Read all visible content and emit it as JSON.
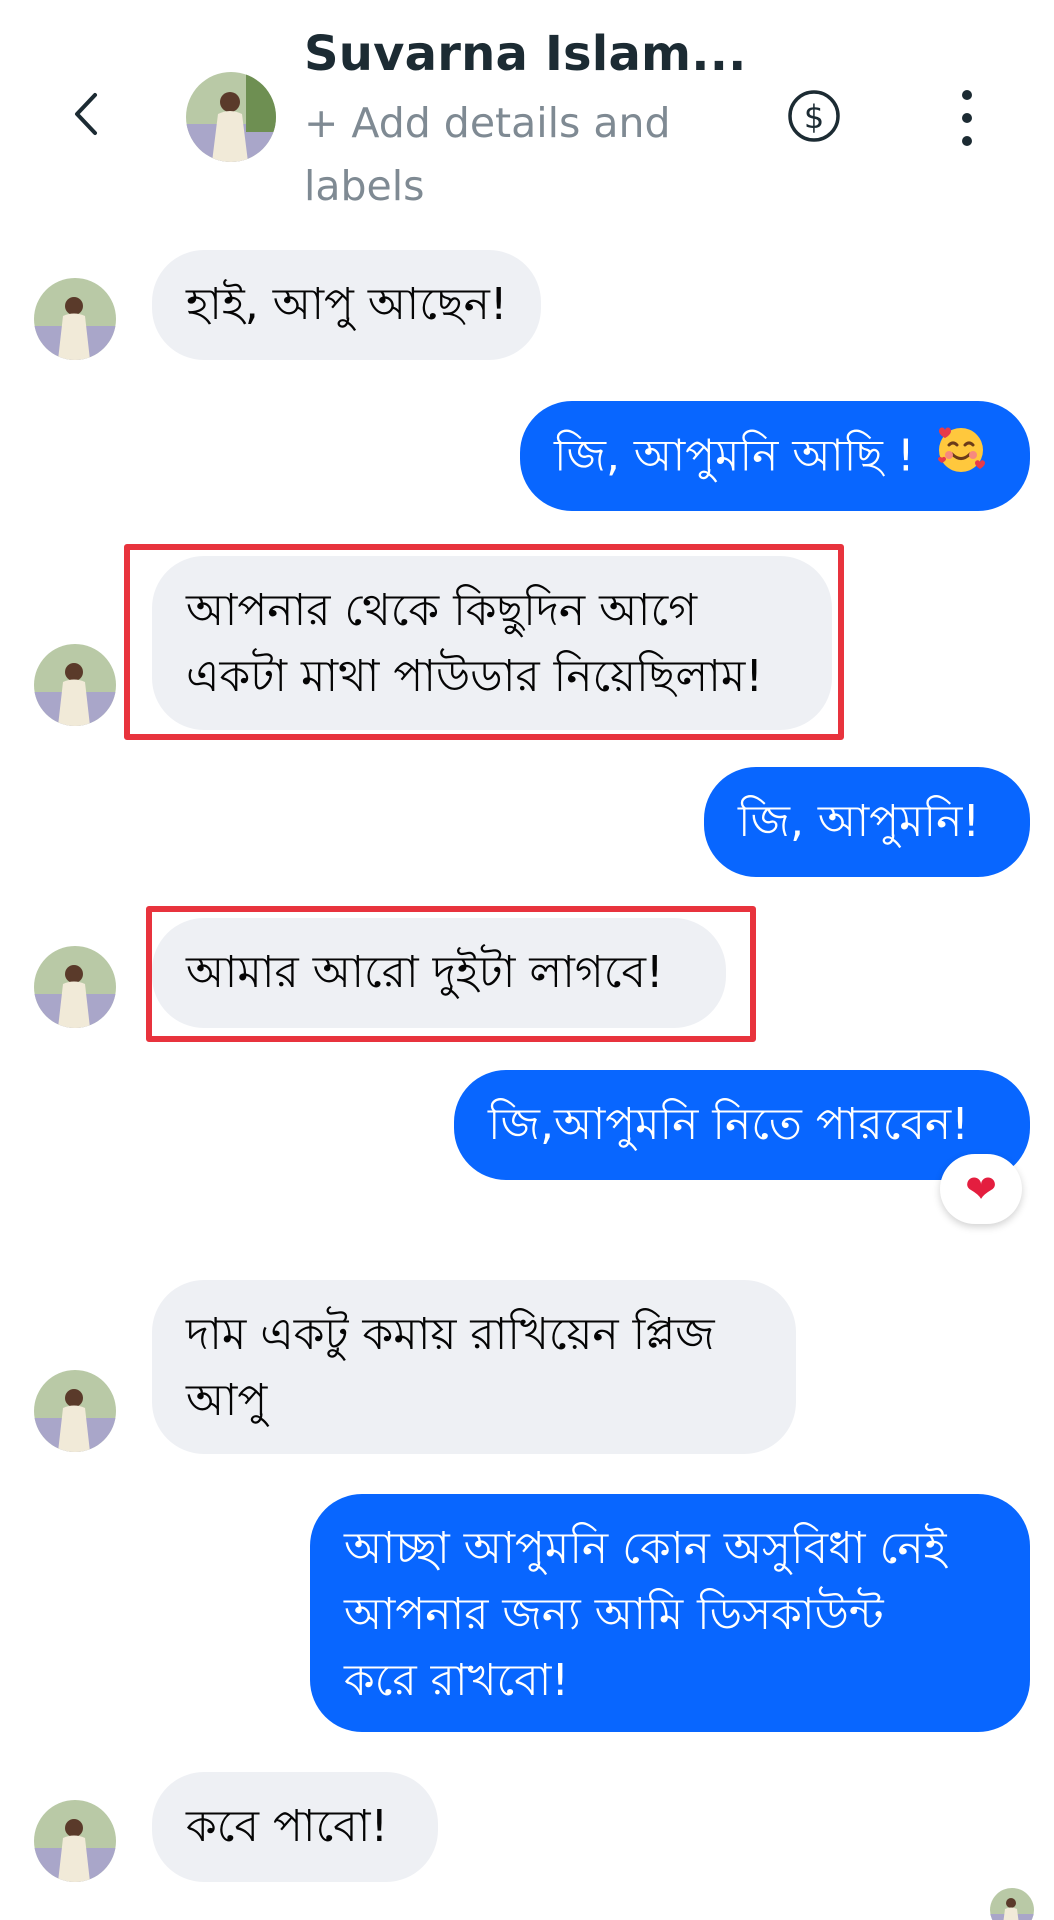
{
  "header": {
    "contact_name": "Suvarna Islam...",
    "subtitle": "+ Add details and labels"
  },
  "messages": [
    {
      "side": "in",
      "text": "হাই,  আপু আছেন!"
    },
    {
      "side": "out",
      "text": "জি, আপুমনি আছি !"
    },
    {
      "side": "in",
      "line1": "আপনার থেকে কিছুদিন আগে",
      "line2": "একটা মাথা পাউডার নিয়েছিলাম!",
      "highlighted": true
    },
    {
      "side": "out",
      "text": "জি, আপুমনি!"
    },
    {
      "side": "in",
      "text": "আমার আরো দুইটা লাগবে!",
      "highlighted": true
    },
    {
      "side": "out",
      "text": "জি,আপুমনি নিতে পারবেন!",
      "reaction": "❤"
    },
    {
      "side": "in",
      "line1": "দাম একটু কমায় রাখিয়েন প্লিজ",
      "line2": "আপু"
    },
    {
      "side": "out",
      "line1": "আচ্ছা আপুমনি  কোন অসুবিধা নেই",
      "line2": "আপনার জন্য আমি ডিসকাউন্ট",
      "line3": "করে  রাখবো!"
    },
    {
      "side": "in",
      "text": "কবে পাবো!"
    }
  ],
  "colors": {
    "outgoing_bubble": "#0866ff",
    "incoming_bubble": "#eef0f4",
    "highlight_border": "#e8333d"
  },
  "icons": [
    "back-chevron-icon",
    "dollar-icon",
    "more-vertical-icon",
    "smiling-face-with-hearts-emoji",
    "heart-reaction-icon"
  ]
}
